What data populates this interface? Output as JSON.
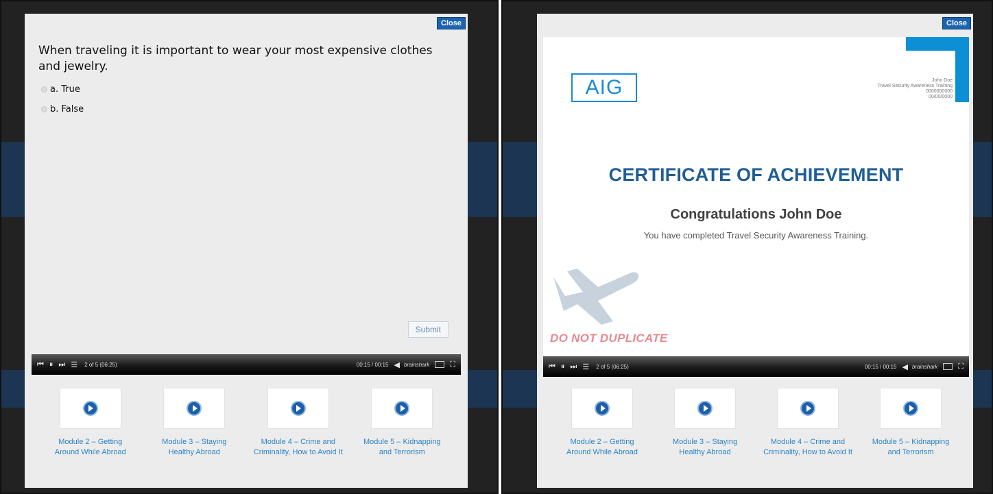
{
  "left": {
    "close": "Close",
    "question": "When traveling it is important to wear your most expensive clothes and jewelry.",
    "options": [
      "a. True",
      "b. False"
    ],
    "submit": "Submit"
  },
  "right": {
    "close": "Close",
    "logo": "AIG",
    "recipient": [
      "John Doe",
      "Travel Security Awareness Training",
      "0000000000",
      "00/00/0000"
    ],
    "title": "CERTIFICATE OF ACHIEVEMENT",
    "congrats": "Congratulations John Doe",
    "subtitle": "You have completed Travel Security Awareness Training.",
    "watermark": "DO NOT DUPLICATE"
  },
  "player": {
    "slides": "2 of 5 (06:25)",
    "time": "00:15 / 00:15",
    "brand": "brainshark"
  },
  "modules": [
    "Module 2 – Getting Around While Abroad",
    "Module 3 – Staying Healthy Abroad",
    "Module 4 – Crime and Criminality, How to Avoid It",
    "Module 5 – Kidnapping and Terrorism"
  ],
  "colors": {
    "accent_blue": "#1a63b0",
    "cert_title": "#1f5e94",
    "watermark": "#e58a91",
    "module_link": "#2d84c7"
  }
}
